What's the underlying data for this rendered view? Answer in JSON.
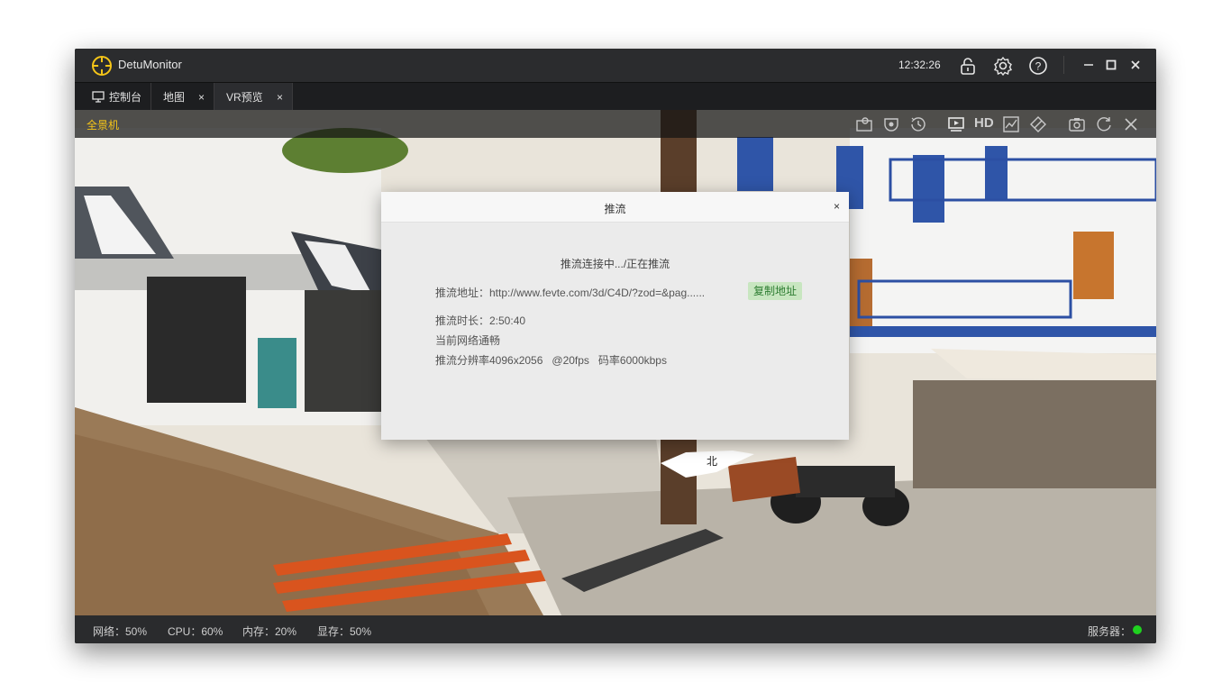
{
  "app": {
    "name": "DetuMonitor",
    "time": "12:32:26"
  },
  "tabs": [
    {
      "label": "控制台",
      "icon": "monitor-icon"
    },
    {
      "label": "地图",
      "close": "×"
    },
    {
      "label": "VR预览",
      "close": "×"
    }
  ],
  "camera": {
    "label": "全景机"
  },
  "camera_toolbar": {
    "hd_label": "HD"
  },
  "dialog": {
    "title": "推流",
    "close": "×",
    "status": "推流连接中.../正在推流",
    "address": "推流地址：http://www.fevte.com/3d/C4D/?zod=&pag......",
    "copy_button": "复制地址",
    "duration": "推流时长：2:50:40",
    "network": "当前网络通畅",
    "resolution": "推流分辨率4096x2056   @20fps   码率6000kbps"
  },
  "overlay": {
    "compass_label": "北"
  },
  "statusbar": {
    "network": "网络：50%",
    "cpu": "CPU：60%",
    "memory": "内存：20%",
    "vram": "显存：50%",
    "server": "服务器："
  },
  "colors": {
    "accent": "#f5c518",
    "server_ok": "#1fd11f",
    "copy_bg": "#c8e6c0"
  }
}
